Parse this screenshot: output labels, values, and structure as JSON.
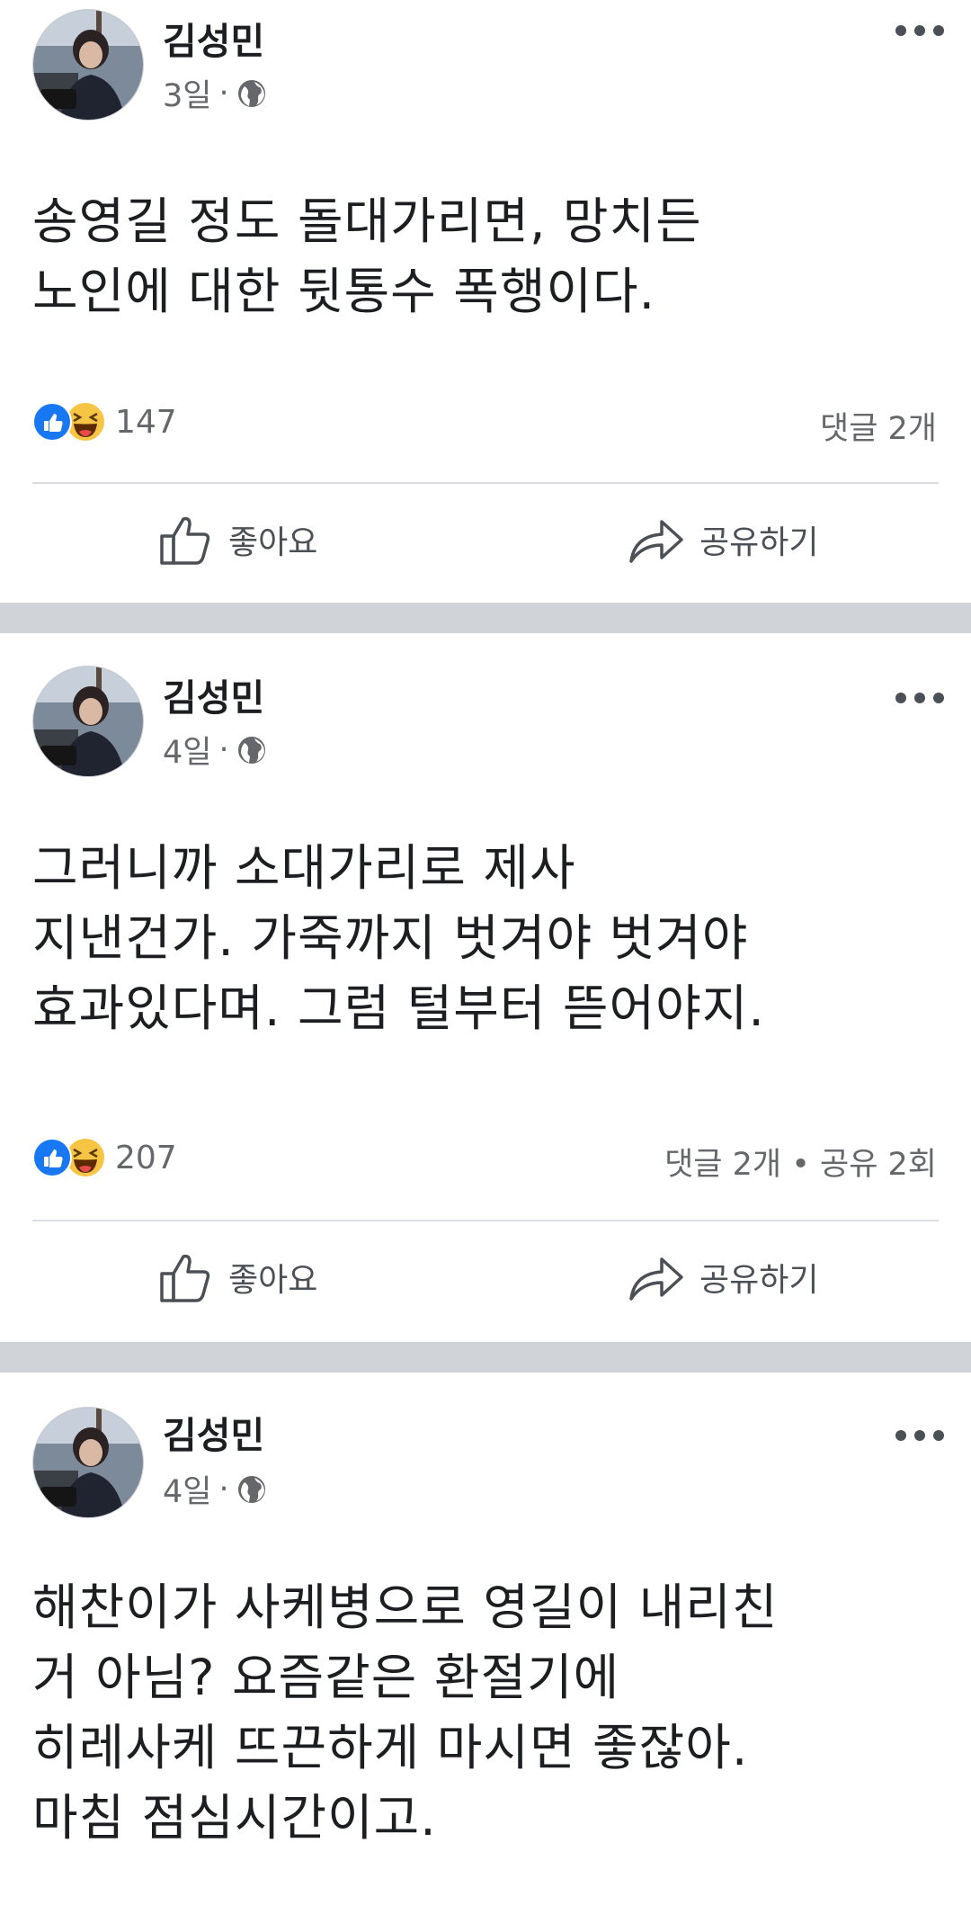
{
  "posts": [
    {
      "author": "김성민",
      "time": "3일",
      "separator": "·",
      "body": "송영길 정도 돌대가리면, 망치든\n노인에 대한 뒷통수 폭행이다.",
      "reaction_count": "147",
      "stats": "댓글 2개",
      "like_label": "좋아요",
      "share_label": "공유하기"
    },
    {
      "author": "김성민",
      "time": "4일",
      "separator": "·",
      "body": "그러니까 소대가리로 제사\n지낸건가. 가죽까지 벗겨야 벗겨야\n효과있다며. 그럼 털부터 뜯어야지.",
      "reaction_count": "207",
      "stats": "댓글 2개 • 공유 2회",
      "like_label": "좋아요",
      "share_label": "공유하기"
    },
    {
      "author": "김성민",
      "time": "4일",
      "separator": "·",
      "body": "해찬이가 사케병으로 영길이 내리친\n거 아님? 요즘같은 환절기에\n히레사케 뜨끈하게 마시면 좋잖아.\n마침 점심시간이고."
    }
  ],
  "icons": {
    "audience": "globe-icon",
    "more": "more-options-icon",
    "like_reaction": "like-reaction-icon",
    "haha_reaction": "haha-reaction-icon",
    "like_action": "thumbs-up-icon",
    "share_action": "share-arrow-icon"
  },
  "colors": {
    "like_blue": "#1877f2",
    "haha_yellow": "#f7c544",
    "secondary_text": "#65676b",
    "divider_band": "#d0d3d8"
  }
}
